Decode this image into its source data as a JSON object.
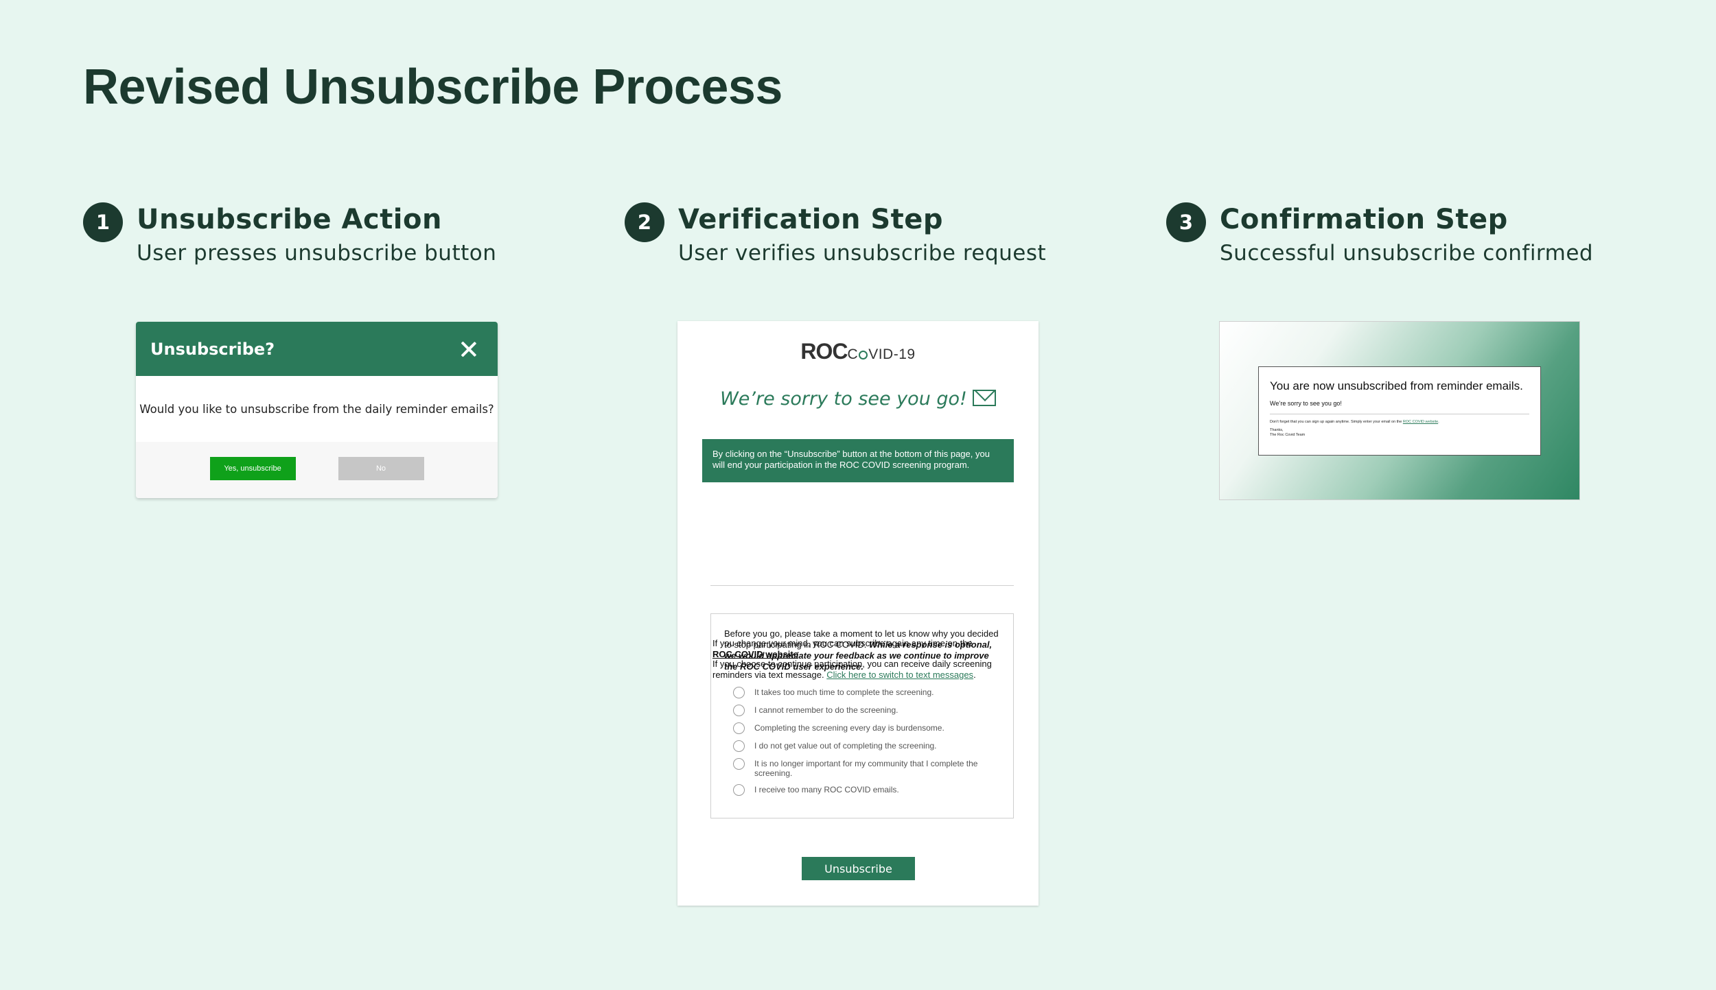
{
  "page_title": "Revised Unsubscribe Process",
  "steps": [
    {
      "number": "1",
      "title": "Unsubscribe Action",
      "subtitle": "User presses unsubscribe button"
    },
    {
      "number": "2",
      "title": "Verification Step",
      "subtitle": "User verifies unsubscribe request"
    },
    {
      "number": "3",
      "title": "Confirmation Step",
      "subtitle": "Successful unsubscribe confirmed"
    }
  ],
  "modal": {
    "title": "Unsubscribe?",
    "close_icon": "close-icon",
    "body": "Would you like to unsubscribe from the daily reminder emails?",
    "yes_label": "Yes, unsubscribe",
    "no_label": "No",
    "colors": {
      "header": "#2b7a5a",
      "yes": "#0fa11a",
      "no": "#c6c6c6"
    }
  },
  "verify": {
    "logo_roc": "ROC",
    "logo_covid_a": "C",
    "logo_covid_b": "VID-19",
    "sorry": "We’re sorry to see you go!",
    "envelope_icon": "envelope-icon",
    "banner": "By clicking on the “Unsubscribe” button at the bottom of this page, you will end your participation in the ROC COVID screening program.",
    "para1_text": "If you change your mind, you can subscribe again any time on the",
    "para1_link": "ROC COVID website",
    "para1_end": ".",
    "para2_text": "If you choose to continue participation, you can receive daily screening reminders via text message.",
    "para2_link": "Click here to switch to text messages",
    "para2_end": ".",
    "survey_intro": "Before you go, please take a moment to let us know why you decided to stop participating in ROC COVID.",
    "survey_intro_bold": "While a response is optional, we would appreciate your feedback as we continue to improve the ROC COVID user experience.",
    "options": [
      "It takes too much time to complete the screening.",
      "I cannot remember to do the screening.",
      "Completing the screening every day is burdensome.",
      "I do not get value out of completing the screening.",
      "It is no longer important for my community that I complete the screening.",
      "I receive too many ROC COVID emails."
    ],
    "unsubscribe_label": "Unsubscribe",
    "accent": "#2b7a5a"
  },
  "confirm": {
    "title": "You are now unsubscribed from reminder emails.",
    "sorry": "We’re sorry to see you go!",
    "reminder_text": "Don’t forget that you can sign up again anytime. Simply enter your email on the",
    "reminder_link": "ROC COVID website",
    "reminder_end": ".",
    "thanks": "Thanks,",
    "team": "The Roc Covid Team"
  }
}
